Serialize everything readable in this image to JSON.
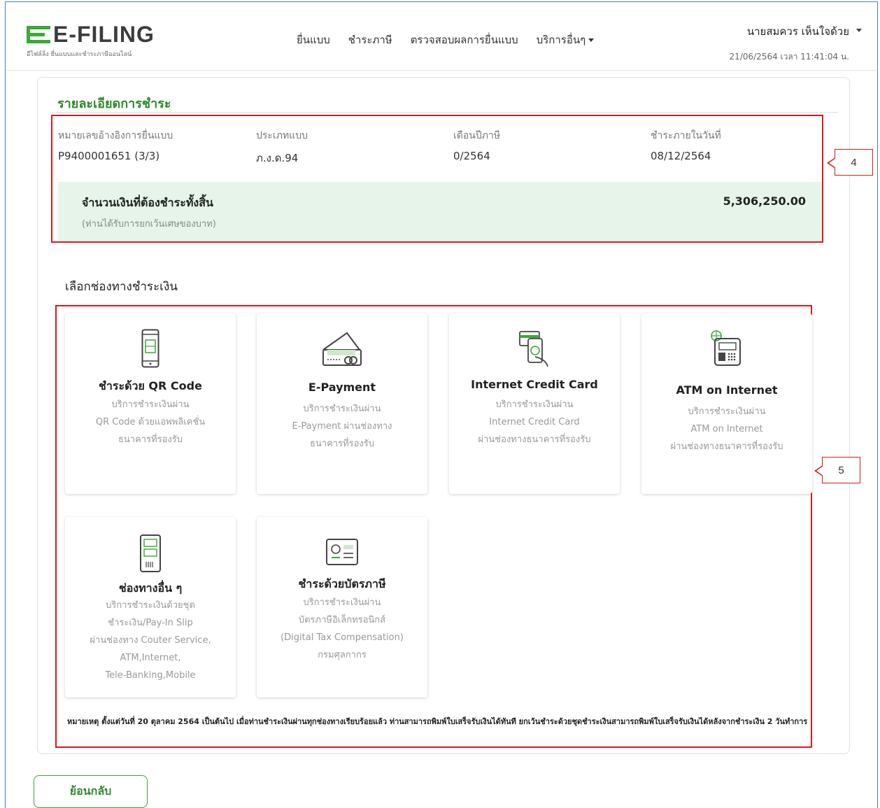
{
  "header": {
    "logo_text": "E-FILING",
    "logo_sub": "อีไฟล์ลิ่ง ยื่นแบบและชำระภาษีออนไลน์",
    "nav": [
      "ยื่นแบบ",
      "ชำระภาษี",
      "ตรวจสอบผลการยื่นแบบ",
      "บริการอื่นๆ"
    ],
    "user_name": "นายสมควร เห็นใจด้วย",
    "datetime": "21/06/2564 เวลา 11:41:04 น."
  },
  "payment": {
    "section_title": "รายละเอียดการชำระ",
    "fields": [
      {
        "label": "หมายเลขอ้างอิงการยื่นแบบ",
        "value": "P9400001651 (3/3)"
      },
      {
        "label": "ประเภทแบบ",
        "value": "ภ.ง.ด.94"
      },
      {
        "label": "เดือนปีภาษี",
        "value": "0/2564"
      },
      {
        "label": "ชำระภายในวันที่",
        "value": "08/12/2564"
      }
    ],
    "amount_label": "จำนวนเงินที่ต้องชำระทั้งสิ้น",
    "amount_note": "(ท่านได้รับการยกเว้นเศษของบาท)",
    "amount_value": "5,306,250.00"
  },
  "choose_title": "เลือกช่องทางชำระเงิน",
  "methods": [
    {
      "title": "ชำระด้วย QR Code",
      "desc": [
        "บริการชำระเงินผ่าน",
        "QR Code ด้วยแอพพลิเคชั่น",
        "ธนาคารที่รองรับ"
      ],
      "icon": "qr-phone-icon"
    },
    {
      "title": "E-Payment",
      "desc": [
        "บริการชำระเงินผ่าน",
        "E-Payment ผ่านช่องทาง",
        "ธนาคารที่รองรับ"
      ],
      "icon": "e-payment-card-icon"
    },
    {
      "title": "Internet Credit Card",
      "desc": [
        "บริการชำระเงินผ่าน",
        "Internet Credit Card",
        "ผ่านช่องทางธนาคารที่รองรับ"
      ],
      "icon": "credit-card-hand-icon"
    },
    {
      "title": "ATM on Internet",
      "desc": [
        "บริการชำระเงินผ่าน",
        "ATM on Internet",
        "ผ่านช่องทางธนาคารที่รองรับ"
      ],
      "icon": "atm-icon"
    },
    {
      "title": "ช่องทางอื่น ๆ",
      "desc": [
        "บริการชำระเงินด้วยชุด",
        "ชำระเงิน/Pay-In Slip",
        "ผ่านช่องทาง Couter Service,",
        "ATM,Internet,",
        "Tele-Banking,Mobile"
      ],
      "icon": "pay-in-slip-icon"
    },
    {
      "title": "ชำระด้วยบัตรภาษี",
      "desc": [
        "บริการชำระเงินผ่าน",
        "บัตรภาษีอิเล็กทรอนิกส์",
        "(Digital Tax Compensation)",
        "กรมศุลกากร"
      ],
      "icon": "tax-card-icon"
    }
  ],
  "footnote": "หมายเหตุ ตั้งแต่วันที่ 20 ตุลาคม 2564 เป็นต้นไป เมื่อท่านชำระเงินผ่านทุกช่องทางเรียบร้อยแล้ว ท่านสามารถพิมพ์ใบเสร็จรับเงินได้ทันที ยกเว้นชำระด้วยชุดชำระเงินสามารถพิมพ์ใบเสร็จรับเงินได้หลังจากชำระเงิน 2 วันทำการ",
  "annotations": {
    "callout_1": "4",
    "callout_2": "5"
  },
  "back_label": "ย้อนกลับ",
  "colors": {
    "brand_green": "#3aa935",
    "highlight_red": "#e0171b",
    "amount_bg": "#e6f4e9"
  }
}
